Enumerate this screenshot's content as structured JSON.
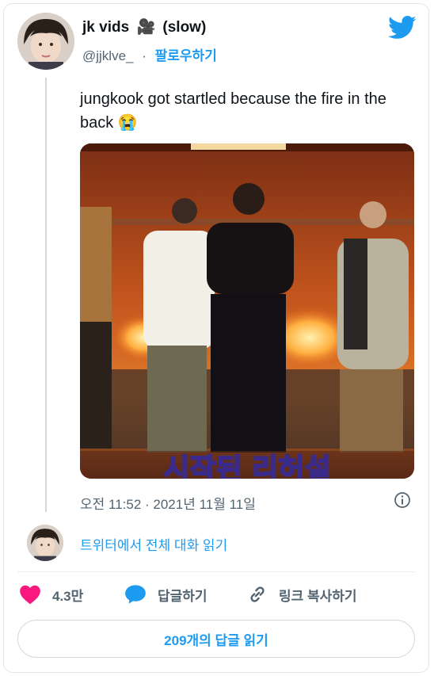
{
  "user": {
    "display_name": "jk vids",
    "name_emoji": "🎥",
    "name_suffix": "(slow)",
    "handle": "@jjklve_",
    "separator": "·",
    "follow_label": "팔로우하기"
  },
  "tweet": {
    "text": "jungkook got startled because the fire in the back",
    "emoji": "😭",
    "media_caption": "시작된 리허설",
    "time": "오전 11:52 · 2021년 11월 11일"
  },
  "conversation": {
    "read_label": "트위터에서 전체 대화 읽기"
  },
  "actions": {
    "like_count": "4.3만",
    "reply_label": "답글하기",
    "copy_link_label": "링크 복사하기"
  },
  "replies_button": {
    "label": "209개의 답글 읽기"
  },
  "colors": {
    "accent": "#1d9bf0",
    "like": "#f91880",
    "secondary_text": "#536471"
  },
  "icons": [
    "twitter-bird-icon",
    "heart-icon",
    "reply-bubble-icon",
    "link-icon",
    "info-icon"
  ]
}
